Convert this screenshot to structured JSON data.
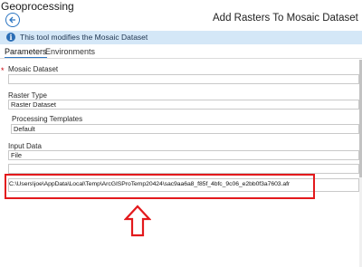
{
  "pane_title": "Geoprocessing",
  "tool_title": "Add Rasters To Mosaic Dataset",
  "info_message": "This tool modifies the Mosaic Dataset",
  "tabs": [
    {
      "label": "Parameters",
      "active": true
    },
    {
      "label": "Environments",
      "active": false
    }
  ],
  "params": {
    "mosaic_dataset": {
      "label": "Mosaic Dataset",
      "required": true,
      "required_marker": "*",
      "value": ""
    },
    "raster_type": {
      "label": "Raster Type",
      "value": "Raster Dataset"
    },
    "processing_templates": {
      "label": "Processing Templates",
      "value": "Default"
    },
    "input_data": {
      "label": "Input Data",
      "value": "File",
      "rows": [
        "",
        "C:\\Users\\joe\\AppData\\Local\\Temp\\ArcGISProTemp20424\\sac9aa6a8_f85f_4bfc_9c06_e2bb0f3a7603.afr"
      ]
    }
  },
  "annotations": {
    "highlight_color": "#e3191c",
    "arrow_color": "#e3191c"
  },
  "colors": {
    "accent": "#2b75c2",
    "info_bg": "#d4e7f7",
    "info_icon": "#2a6db5"
  },
  "icons": {
    "back": "back-arrow-circle-icon",
    "info": "info-icon",
    "annotation_arrow": "up-arrow-outline-icon"
  }
}
